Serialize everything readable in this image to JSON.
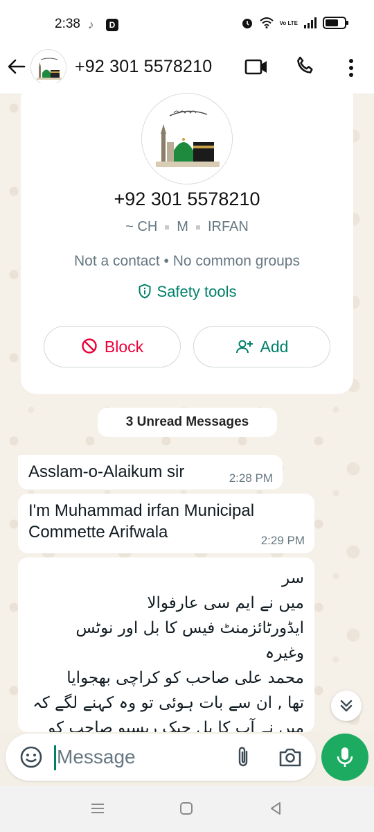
{
  "status_bar": {
    "time": "2:38",
    "volte": "Vo LTE"
  },
  "header": {
    "title": "+92 301 5578210",
    "icons": [
      "back-arrow-icon",
      "video-call-icon",
      "phone-call-icon",
      "more-options-icon"
    ]
  },
  "contact_card": {
    "phone": "+92 301 5578210",
    "name_parts": [
      "~ CH",
      "M",
      "IRFAN"
    ],
    "meta": "Not a contact • No common groups",
    "safety_label": "Safety tools",
    "block_label": "Block",
    "add_label": "Add",
    "colors": {
      "block": "#ea0038",
      "accent": "#008069"
    }
  },
  "unread_label": "3 Unread Messages",
  "messages": [
    {
      "text": "Asslam-o-Alaikum sir",
      "time": "2:28 PM"
    },
    {
      "text": "I'm Muhammad irfan Municipal Commette Arifwala",
      "time": "2:29 PM"
    },
    {
      "lines": [
        "سر",
        "میں نے ایم سی عارفوالا",
        "ایڈورٹائزمنٹ فیس کا بل اور نوٹس",
        "وغیرہ",
        "محمد علی صاحب کو کراچی بھجوایا",
        "تھا , ان سے بات ہوئی تو وہ کہنے لگے کہ",
        "میں نے آپ کا بل چیک ریسیو صاحب کو"
      ]
    }
  ],
  "composer": {
    "placeholder": "Message"
  },
  "colors": {
    "send_button": "#1daa61"
  }
}
